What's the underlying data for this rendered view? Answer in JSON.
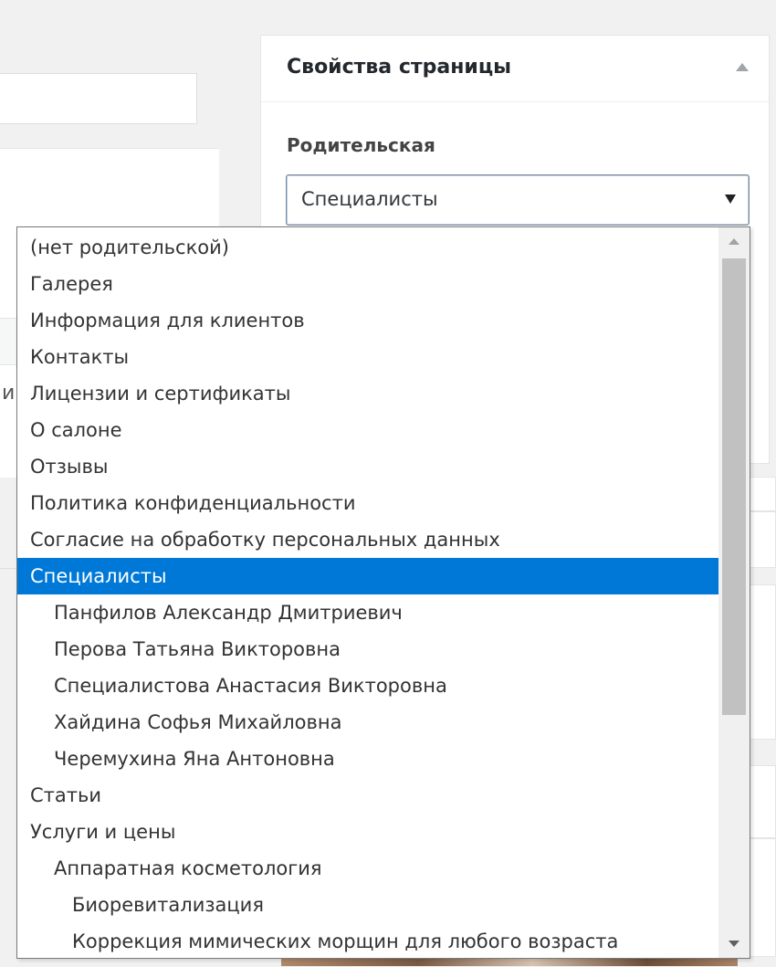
{
  "page_attributes": {
    "title": "Свойства страницы",
    "parent_label": "Родительская",
    "parent_selected": "Специалисты"
  },
  "dropdown": {
    "options": [
      {
        "label": "(нет родительской)",
        "level": 0
      },
      {
        "label": "Галерея",
        "level": 0
      },
      {
        "label": "Информация для клиентов",
        "level": 0
      },
      {
        "label": "Контакты",
        "level": 0
      },
      {
        "label": "Лицензии и сертификаты",
        "level": 0
      },
      {
        "label": "О салоне",
        "level": 0
      },
      {
        "label": "Отзывы",
        "level": 0
      },
      {
        "label": "Политика конфиденциальности",
        "level": 0
      },
      {
        "label": "Согласие на обработку персональных данных",
        "level": 0
      },
      {
        "label": "Специалисты",
        "level": 0,
        "selected": true
      },
      {
        "label": "Панфилов Александр Дмитриевич",
        "level": 1
      },
      {
        "label": "Перова Татьяна Викторовна",
        "level": 1
      },
      {
        "label": "Специалистова Анастасия Викторовна",
        "level": 1
      },
      {
        "label": "Хайдина Софья Михайловна",
        "level": 1
      },
      {
        "label": "Черемухина Яна Антоновна",
        "level": 1
      },
      {
        "label": "Статьи",
        "level": 0
      },
      {
        "label": "Услуги и цены",
        "level": 0
      },
      {
        "label": "Аппаратная косметология",
        "level": 1
      },
      {
        "label": "Биоревитализация",
        "level": 2
      },
      {
        "label": "Коррекция мимических морщин для любого возраста",
        "level": 2
      }
    ]
  },
  "left_partial_text": "и",
  "colors": {
    "selected_bg": "#0078d7",
    "selected_fg": "#ffffff",
    "panel_bg": "#ffffff",
    "page_bg": "#f1f1f1"
  }
}
